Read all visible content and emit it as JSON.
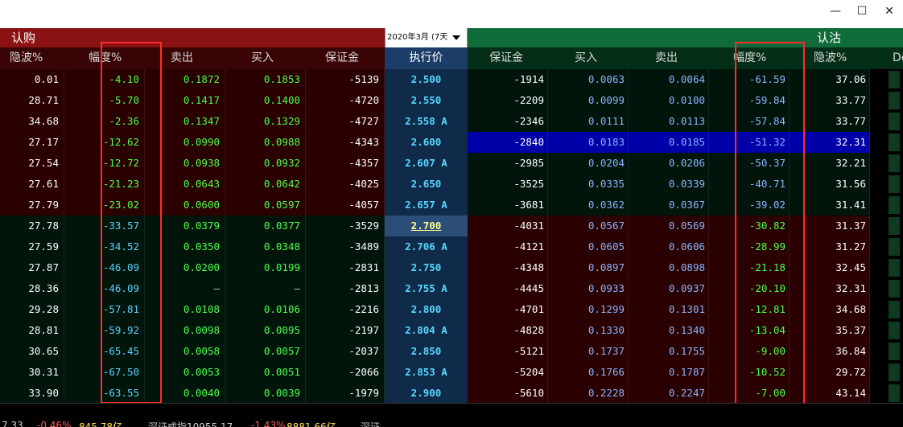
{
  "window": {
    "minimize": "—",
    "maximize": "☐",
    "close": "✕"
  },
  "header": {
    "call_title": "认购",
    "put_title": "认沽",
    "month": "2020年3月 (7天"
  },
  "columns": {
    "call": [
      "隐波%",
      "幅度%",
      "卖出",
      "买入",
      "保证金"
    ],
    "strike": "执行价",
    "put": [
      "保证金",
      "买入",
      "卖出",
      "幅度%",
      "隐波%",
      "De"
    ]
  },
  "rows": [
    {
      "c_iv": "0.01",
      "c_chg": "-4.10",
      "c_ask": "0.1872",
      "c_bid": "0.1853",
      "c_margin": "-5139",
      "strike": "2.500",
      "p_margin": "-1914",
      "p_bid": "0.0063",
      "p_ask": "0.0064",
      "p_chg": "-61.59",
      "p_iv": "37.06"
    },
    {
      "c_iv": "28.71",
      "c_chg": "-5.70",
      "c_ask": "0.1417",
      "c_bid": "0.1400",
      "c_margin": "-4720",
      "strike": "2.550",
      "p_margin": "-2209",
      "p_bid": "0.0099",
      "p_ask": "0.0100",
      "p_chg": "-59.84",
      "p_iv": "33.77"
    },
    {
      "c_iv": "34.68",
      "c_chg": "-2.36",
      "c_ask": "0.1347",
      "c_bid": "0.1329",
      "c_margin": "-4727",
      "strike": "2.558 A",
      "p_margin": "-2346",
      "p_bid": "0.0111",
      "p_ask": "0.0113",
      "p_chg": "-57.84",
      "p_iv": "33.77"
    },
    {
      "c_iv": "27.17",
      "c_chg": "-12.62",
      "c_ask": "0.0990",
      "c_bid": "0.0988",
      "c_margin": "-4343",
      "strike": "2.600",
      "p_margin": "-2840",
      "p_bid": "0.0183",
      "p_ask": "0.0185",
      "p_chg": "-51.32",
      "p_iv": "32.31"
    },
    {
      "c_iv": "27.54",
      "c_chg": "-12.72",
      "c_ask": "0.0938",
      "c_bid": "0.0932",
      "c_margin": "-4357",
      "strike": "2.607 A",
      "p_margin": "-2985",
      "p_bid": "0.0204",
      "p_ask": "0.0206",
      "p_chg": "-50.37",
      "p_iv": "32.21"
    },
    {
      "c_iv": "27.61",
      "c_chg": "-21.23",
      "c_ask": "0.0643",
      "c_bid": "0.0642",
      "c_margin": "-4025",
      "strike": "2.650",
      "p_margin": "-3525",
      "p_bid": "0.0335",
      "p_ask": "0.0339",
      "p_chg": "-40.71",
      "p_iv": "31.56"
    },
    {
      "c_iv": "27.79",
      "c_chg": "-23.02",
      "c_ask": "0.0600",
      "c_bid": "0.0597",
      "c_margin": "-4057",
      "strike": "2.657 A",
      "p_margin": "-3681",
      "p_bid": "0.0362",
      "p_ask": "0.0367",
      "p_chg": "-39.02",
      "p_iv": "31.41"
    },
    {
      "c_iv": "27.78",
      "c_chg": "-33.57",
      "c_ask": "0.0379",
      "c_bid": "0.0377",
      "c_margin": "-3529",
      "strike": "2.700",
      "p_margin": "-4031",
      "p_bid": "0.0567",
      "p_ask": "0.0569",
      "p_chg": "-30.82",
      "p_iv": "31.37"
    },
    {
      "c_iv": "27.59",
      "c_chg": "-34.52",
      "c_ask": "0.0350",
      "c_bid": "0.0348",
      "c_margin": "-3489",
      "strike": "2.706 A",
      "p_margin": "-4121",
      "p_bid": "0.0605",
      "p_ask": "0.0606",
      "p_chg": "-28.99",
      "p_iv": "31.27"
    },
    {
      "c_iv": "27.87",
      "c_chg": "-46.09",
      "c_ask": "0.0200",
      "c_bid": "0.0199",
      "c_margin": "-2831",
      "strike": "2.750",
      "p_margin": "-4348",
      "p_bid": "0.0897",
      "p_ask": "0.0898",
      "p_chg": "-21.18",
      "p_iv": "32.45"
    },
    {
      "c_iv": "28.36",
      "c_chg": "-46.09",
      "c_ask": "—",
      "c_bid": "—",
      "c_margin": "-2813",
      "strike": "2.755 A",
      "p_margin": "-4445",
      "p_bid": "0.0933",
      "p_ask": "0.0937",
      "p_chg": "-20.10",
      "p_iv": "32.31"
    },
    {
      "c_iv": "29.28",
      "c_chg": "-57.81",
      "c_ask": "0.0108",
      "c_bid": "0.0106",
      "c_margin": "-2216",
      "strike": "2.800",
      "p_margin": "-4701",
      "p_bid": "0.1299",
      "p_ask": "0.1301",
      "p_chg": "-12.81",
      "p_iv": "34.68"
    },
    {
      "c_iv": "28.81",
      "c_chg": "-59.92",
      "c_ask": "0.0098",
      "c_bid": "0.0095",
      "c_margin": "-2197",
      "strike": "2.804 A",
      "p_margin": "-4828",
      "p_bid": "0.1330",
      "p_ask": "0.1340",
      "p_chg": "-13.04",
      "p_iv": "35.37"
    },
    {
      "c_iv": "30.65",
      "c_chg": "-65.45",
      "c_ask": "0.0058",
      "c_bid": "0.0057",
      "c_margin": "-2037",
      "strike": "2.850",
      "p_margin": "-5121",
      "p_bid": "0.1737",
      "p_ask": "0.1755",
      "p_chg": "-9.00",
      "p_iv": "36.84"
    },
    {
      "c_iv": "30.31",
      "c_chg": "-67.50",
      "c_ask": "0.0053",
      "c_bid": "0.0051",
      "c_margin": "-2066",
      "strike": "2.853 A",
      "p_margin": "-5204",
      "p_bid": "0.1766",
      "p_ask": "0.1787",
      "p_chg": "-10.52",
      "p_iv": "29.72"
    },
    {
      "c_iv": "33.90",
      "c_chg": "-63.55",
      "c_ask": "0.0040",
      "c_bid": "0.0039",
      "c_margin": "-1979",
      "strike": "2.900",
      "p_margin": "-5610",
      "p_bid": "0.2228",
      "p_ask": "0.2247",
      "p_chg": "-7.00",
      "p_iv": "43.14"
    }
  ],
  "state": {
    "itm_call_rows": 7,
    "selected_put_row": 3,
    "selected_strike_row": 7
  },
  "statusbar": {
    "items": [
      "7.33",
      "-0.46%",
      "845.78亿",
      "深证成指10955.17",
      "-1.43%",
      "8881.66亿",
      "深证..."
    ]
  }
}
